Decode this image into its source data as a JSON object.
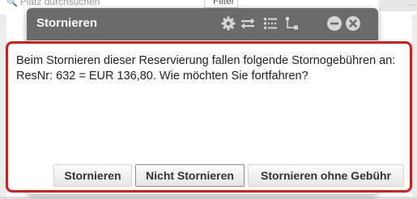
{
  "background": {
    "search_placeholder": "Platz durchsuchen",
    "filter_label": "Filter"
  },
  "dialog": {
    "title": "Stornieren",
    "message": "Beim Stornieren dieser Reservierung fallen folgende Stornogebühren an: ResNr: 632 = EUR 136,80. Wie möchten Sie fortfahren?",
    "buttons": {
      "cancel": "Stornieren",
      "dont_cancel": "Nicht Stornieren",
      "cancel_no_fee": "Stornieren ohne Gebühr"
    },
    "titlebar_icons": [
      "gear-icon",
      "swap-icon",
      "list-tree-icon",
      "hierarchy-icon",
      "minimize-icon",
      "close-icon"
    ]
  },
  "colors": {
    "titlebar": "#6b6b6b",
    "highlight": "#e01818",
    "icon_light": "#d6d6d6"
  }
}
